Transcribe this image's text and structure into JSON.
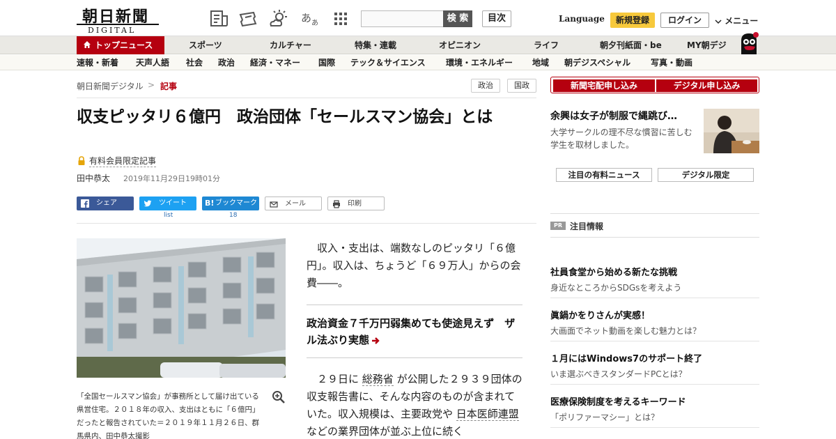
{
  "header": {
    "logo_main": "朝日新聞",
    "logo_sub": "DIGITAL",
    "search_placeholder": "",
    "search_button": "検 索",
    "toc_button": "目次",
    "language": "Language",
    "register": "新規登録",
    "login": "ログイン",
    "menu": "メニュー"
  },
  "nav_primary": [
    "トップニュース",
    "スポーツ",
    "カルチャー",
    "特集・連載",
    "オピニオン",
    "ライフ",
    "朝夕刊紙面・be",
    "MY朝デジ"
  ],
  "nav_secondary": [
    "速報・新着",
    "天声人語",
    "社会",
    "政治",
    "経済・マネー",
    "国際",
    "テック＆サイエンス",
    "環境・エネルギー",
    "地域",
    "朝デジスペシャル",
    "写真・動画"
  ],
  "breadcrumb": {
    "home": "朝日新聞デジタル",
    "separator": ">",
    "current": "記事"
  },
  "tags": [
    "政治",
    "国政"
  ],
  "article": {
    "title": "収支ピッタリ６億円　政治団体「セールスマン協会」とは",
    "members_only": "有料会員限定記事",
    "author": "田中恭太",
    "date": "2019年11月29日19時01分",
    "lead": "収入・支出は、端数なしのピッタリ「６億円」。収入は、ちょうど「６９万人」からの会費――。",
    "related": "政治資金７千万円弱集めても使途見えず　ザル法ぶり実態",
    "body_parts": [
      "２９日に ",
      "総務省",
      " が公開した２９３９団体の収支報告書に、そんな内容のものが含まれていた。収入規模は、主要政党や ",
      "日本医師連盟",
      " などの業界団体が並ぶ上位に続く"
    ],
    "caption": "「全国セールスマン協会」が事務所として届け出ている県営住宅。２０１８年の収入、支出はともに「６億円」だったと報告されていた＝２０１９年１１月２６日、群馬県内、田中恭太撮影"
  },
  "share": {
    "facebook": "シェア",
    "twitter": "ツイート",
    "twitter_count": "list",
    "hatena": "ブックマーク",
    "hatena_icon": "B!",
    "hatena_count": "18",
    "mail": "メール",
    "print": "印刷"
  },
  "sidebar": {
    "subscribe_paper": "新聞宅配申し込み",
    "subscribe_digital": "デジタル申し込み",
    "promo_title": "余興は女子が制服で縄跳び…",
    "promo_desc": "大学サークルの理不尽な慣習に苦しむ学生を取材しました。",
    "tab_paid": "注目の有料ニュース",
    "tab_digital": "デジタル限定",
    "pr_badge": "PR",
    "pr_label": "注目情報",
    "ads": [
      {
        "title": "社員食堂から始める新たな挑戦",
        "sub": "身近なところからSDGsを考えよう"
      },
      {
        "title": "眞鍋かをりさんが実感！",
        "sub": "大画面でネット動画を楽しむ魅力とは？"
      },
      {
        "title": "１月にはWindows7のサポート終了",
        "sub": "いま選ぶべきスタンダードPCとは？"
      },
      {
        "title": "医療保険制度を考えるキーワード",
        "sub": "「ポリファーマシー」とは？"
      }
    ]
  },
  "colors": {
    "brand_red": "#b5000f",
    "register_yellow": "#f7c93c",
    "facebook": "#3b5998",
    "twitter": "#1da1f2",
    "hatena": "#1e88d3"
  }
}
